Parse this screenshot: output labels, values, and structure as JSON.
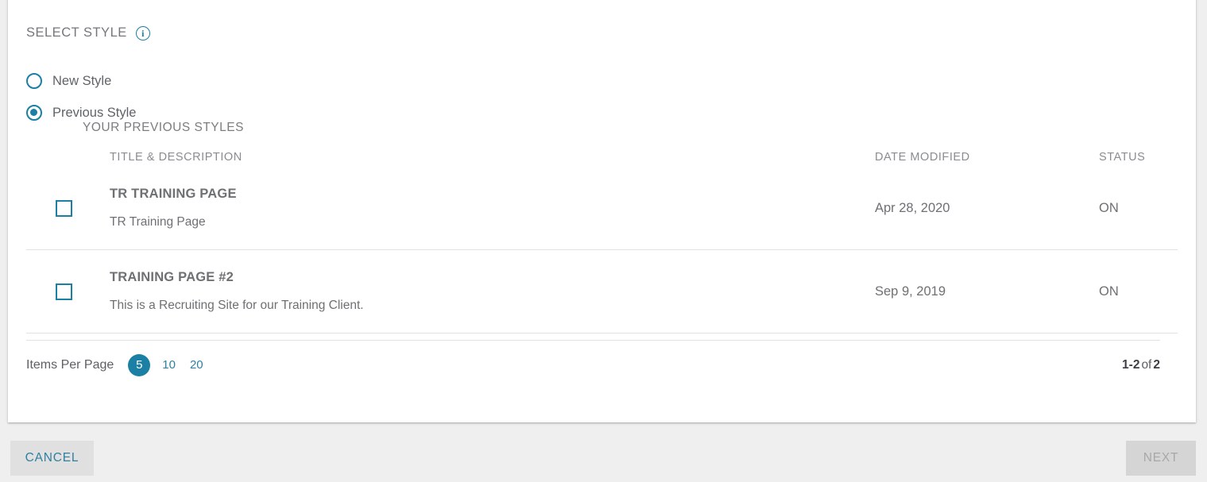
{
  "section": {
    "title": "SELECT STYLE",
    "info_icon": "info-icon",
    "info_glyph": "i"
  },
  "style_options": [
    {
      "label": "New Style",
      "selected": false
    },
    {
      "label": "Previous Style",
      "selected": true
    }
  ],
  "table": {
    "caption": "YOUR PREVIOUS STYLES",
    "columns": [
      "TITLE & DESCRIPTION",
      "DATE MODIFIED",
      "STATUS"
    ],
    "rows": [
      {
        "checked": false,
        "title": "TR TRAINING PAGE",
        "description": "TR Training Page",
        "date_modified": "Apr 28, 2020",
        "status": "ON"
      },
      {
        "checked": false,
        "title": "TRAINING PAGE #2",
        "description": "This is a Recruiting Site for our Training Client.",
        "date_modified": "Sep 9, 2019",
        "status": "ON"
      }
    ]
  },
  "pagination": {
    "items_per_page_label": "Items Per Page",
    "options": [
      "5",
      "10",
      "20"
    ],
    "selected_option": "5",
    "range": "1-2",
    "of_label": "of",
    "total": "2"
  },
  "footer": {
    "cancel_label": "CANCEL",
    "next_label": "NEXT"
  },
  "colors": {
    "accent": "#1b80a4",
    "link": "#2f80a0",
    "text": "#6e7073",
    "muted": "#8a8c8f",
    "page_bg": "#efeff0",
    "card_bg": "#ffffff",
    "divider": "#e2e2e3",
    "button_bg": "#e0e0e0",
    "button_disabled_bg": "#d5d5d5",
    "button_disabled_text": "#a7a8aa"
  }
}
